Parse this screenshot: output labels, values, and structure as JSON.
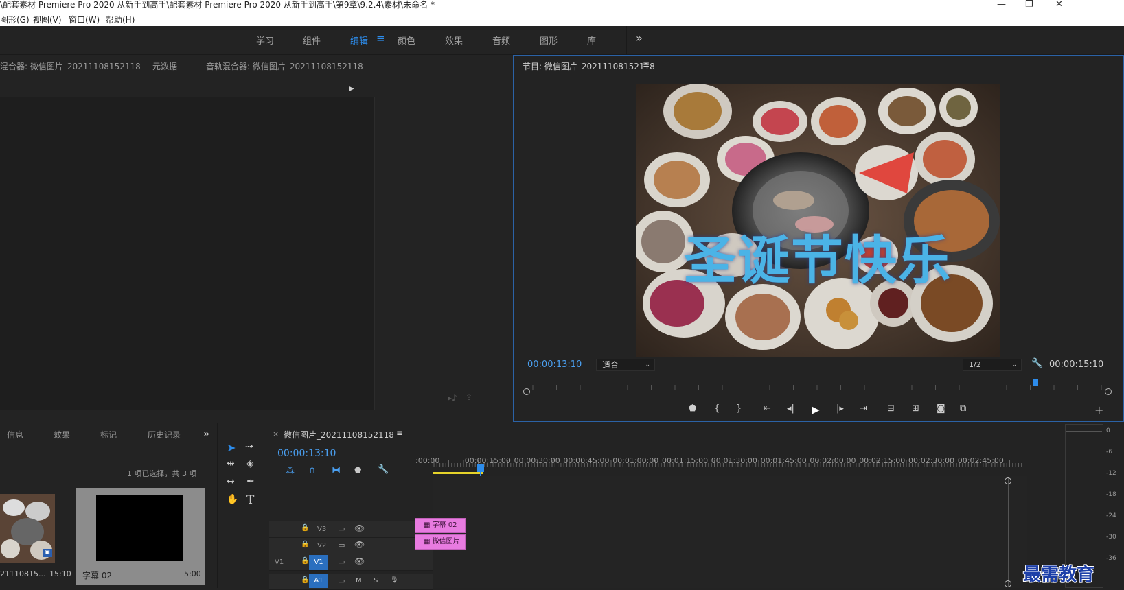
{
  "window": {
    "title": "\\配套素材 Premiere Pro 2020 从新手到高手\\配套素材 Premiere Pro 2020 从新手到高手\\第9章\\9.2.4\\素材\\未命名 *",
    "minimize": "—",
    "restore": "❐",
    "close": "✕"
  },
  "menu": [
    "图形(G)",
    "视图(V)",
    "窗口(W)",
    "帮助(H)"
  ],
  "workspaces": {
    "items": [
      "学习",
      "组件",
      "编辑",
      "颜色",
      "效果",
      "音频",
      "图形",
      "库"
    ],
    "active": "编辑",
    "more": "»",
    "menu_icon": "≡"
  },
  "source_panel": {
    "tabs": [
      "混合器: 微信图片_20211108152118",
      "元数据",
      "音轨混合器: 微信图片_20211108152118"
    ]
  },
  "program": {
    "title": "节目: 微信图片_20211108152118",
    "menu_icon": "≡",
    "overlay_text": "圣诞节快乐",
    "current_time": "00:00:13:10",
    "fit": "适合",
    "resolution": "1/2",
    "duration": "00:00:15:10",
    "playhead_fraction": 0.87
  },
  "project": {
    "tabs": [
      "信息",
      "效果",
      "标记",
      "历史记录"
    ],
    "more": "»",
    "selection_info": "1 项已选择，共 3 项",
    "items": [
      {
        "name": "21110815...",
        "duration": "15:10"
      },
      {
        "name": "字幕 02",
        "duration": "5:00"
      }
    ]
  },
  "timeline": {
    "close": "×",
    "sequence_name": "微信图片_20211108152118",
    "menu_icon": "≡",
    "current_time": "00:00:13:10",
    "ruler": [
      ":00:00",
      "00:00:15:00",
      "00:00:30:00",
      "00:00:45:00",
      "00:01:00:00",
      "00:01:15:00",
      "00:01:30:00",
      "00:01:45:00",
      "00:02:00:00",
      "00:02:15:00",
      "00:02:30:00",
      "00:02:45:00"
    ],
    "tracks": [
      {
        "id": "V3",
        "label": "V3"
      },
      {
        "id": "V2",
        "label": "V2"
      },
      {
        "id": "V1",
        "label": "V1",
        "source": "V1"
      },
      {
        "id": "A1",
        "label": "A1",
        "m": "M",
        "s": "S"
      }
    ],
    "clips": [
      {
        "track": "V2",
        "label": "字幕 02"
      },
      {
        "track": "V1",
        "label": "微信图片"
      }
    ]
  },
  "meter": {
    "scale": [
      "0",
      "-6",
      "-12",
      "-18",
      "-24",
      "-30",
      "-36"
    ]
  },
  "watermark": "最需教育",
  "colors": {
    "accent": "#2d8ceb",
    "clip": "#e87be0",
    "panel": "#232323",
    "overlay_text": "#4bb3e6"
  }
}
